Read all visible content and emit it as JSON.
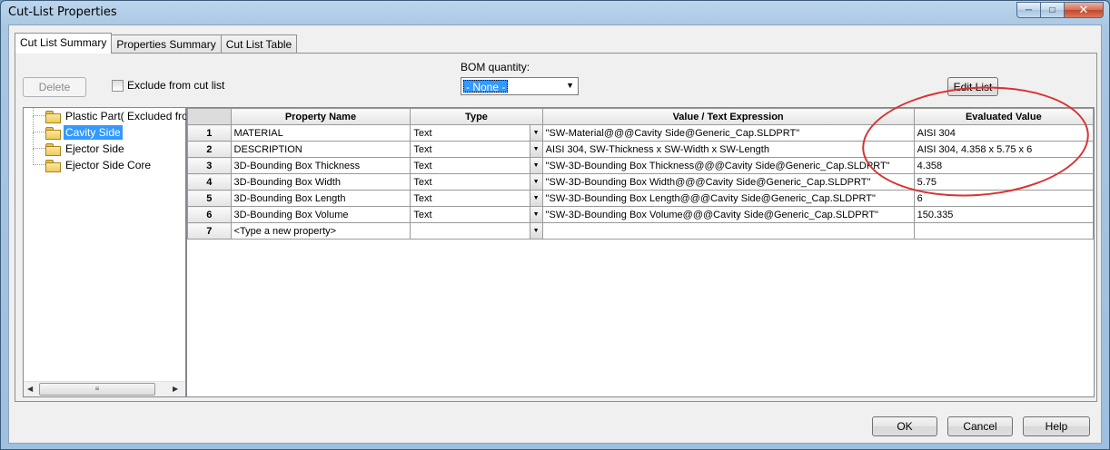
{
  "window": {
    "title": "Cut-List Properties"
  },
  "tabs": [
    {
      "label": "Cut List Summary"
    },
    {
      "label": "Properties Summary"
    },
    {
      "label": "Cut List Table"
    }
  ],
  "toolbar": {
    "delete_label": "Delete",
    "exclude_label": "Exclude from cut list",
    "bom_label": "BOM quantity:",
    "bom_value": "- None -",
    "edit_list_label": "Edit List"
  },
  "tree": {
    "items": [
      {
        "label": "Plastic Part( Excluded from c"
      },
      {
        "label": "Cavity Side"
      },
      {
        "label": "Ejector Side"
      },
      {
        "label": "Ejector Side Core"
      }
    ]
  },
  "grid": {
    "headers": [
      "Property Name",
      "Type",
      "Value / Text Expression",
      "Evaluated Value"
    ],
    "rows": [
      {
        "n": "1",
        "name": "MATERIAL",
        "type": "Text",
        "expr": "\"SW-Material@@@Cavity Side@Generic_Cap.SLDPRT\"",
        "value": "AISI 304"
      },
      {
        "n": "2",
        "name": "DESCRIPTION",
        "type": "Text",
        "expr": "AISI 304, SW-Thickness x SW-Width x SW-Length",
        "value": "AISI 304, 4.358 x 5.75 x 6"
      },
      {
        "n": "3",
        "name": "3D-Bounding Box Thickness",
        "type": "Text",
        "expr": "\"SW-3D-Bounding Box Thickness@@@Cavity Side@Generic_Cap.SLDPRT\"",
        "value": "4.358"
      },
      {
        "n": "4",
        "name": "3D-Bounding Box Width",
        "type": "Text",
        "expr": "\"SW-3D-Bounding Box Width@@@Cavity Side@Generic_Cap.SLDPRT\"",
        "value": "5.75"
      },
      {
        "n": "5",
        "name": "3D-Bounding Box Length",
        "type": "Text",
        "expr": "\"SW-3D-Bounding Box Length@@@Cavity Side@Generic_Cap.SLDPRT\"",
        "value": "6"
      },
      {
        "n": "6",
        "name": "3D-Bounding Box Volume",
        "type": "Text",
        "expr": "\"SW-3D-Bounding Box Volume@@@Cavity Side@Generic_Cap.SLDPRT\"",
        "value": "150.335"
      },
      {
        "n": "7",
        "name": "<Type a new property>",
        "type": "",
        "expr": "",
        "value": ""
      }
    ]
  },
  "footer": {
    "ok_label": "OK",
    "cancel_label": "Cancel",
    "help_label": "Help"
  },
  "colors": {
    "selection": "#3399ff",
    "annotation_circle": "#d93232"
  }
}
